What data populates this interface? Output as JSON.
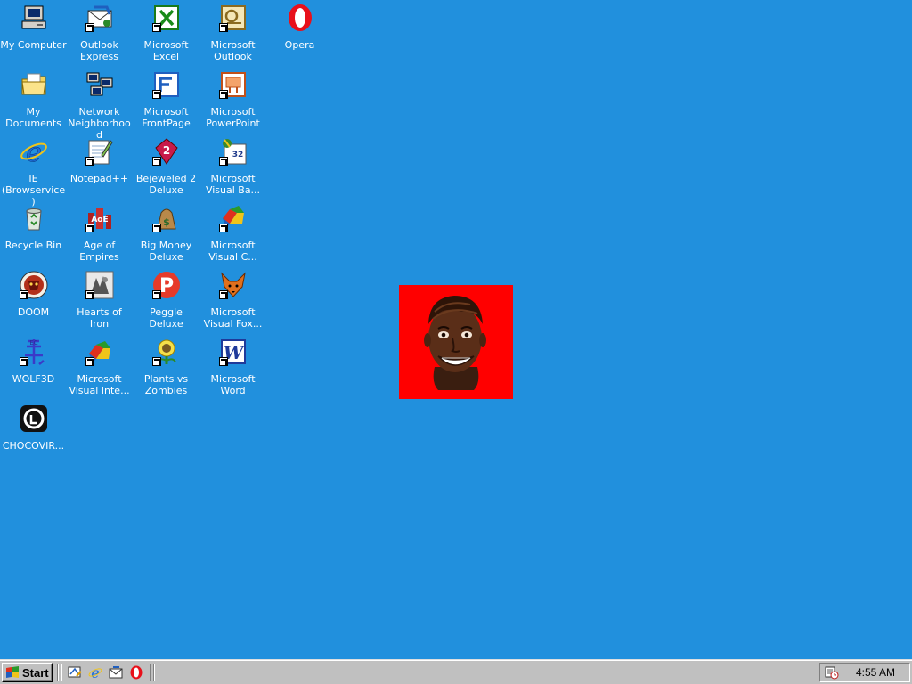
{
  "desktop": {
    "background_color": "#2190dd",
    "icons": [
      {
        "label": "My Computer",
        "icon": "my-computer-icon"
      },
      {
        "label": "My Documents",
        "icon": "my-documents-icon"
      },
      {
        "label": "IE\n(Browservice)",
        "icon": "internet-explorer-icon"
      },
      {
        "label": "Recycle Bin",
        "icon": "recycle-bin-icon"
      },
      {
        "label": "DOOM",
        "icon": "doom-icon"
      },
      {
        "label": "WOLF3D",
        "icon": "wolf3d-icon"
      },
      {
        "label": "CHOCOVIR...",
        "icon": "chocovir-icon"
      },
      {
        "label": "Outlook\nExpress",
        "icon": "outlook-express-icon"
      },
      {
        "label": "Network\nNeighborhood",
        "icon": "network-neighborhood-icon"
      },
      {
        "label": "Notepad++",
        "icon": "notepad-plus-plus-icon"
      },
      {
        "label": "Age of\nEmpires",
        "icon": "age-of-empires-icon"
      },
      {
        "label": "Hearts of Iron",
        "icon": "hearts-of-iron-icon"
      },
      {
        "label": "Microsoft\nVisual Inte...",
        "icon": "visual-interdev-icon"
      },
      {
        "label": "Microsoft\nExcel",
        "icon": "excel-icon"
      },
      {
        "label": "Microsoft\nFrontPage",
        "icon": "frontpage-icon"
      },
      {
        "label": "Bejeweled 2\nDeluxe",
        "icon": "bejeweled-icon"
      },
      {
        "label": "Big Money\nDeluxe",
        "icon": "big-money-icon"
      },
      {
        "label": "Peggle Deluxe",
        "icon": "peggle-icon"
      },
      {
        "label": "Plants vs\nZombies",
        "icon": "plants-vs-zombies-icon"
      },
      {
        "label": "Microsoft\nOutlook",
        "icon": "outlook-icon"
      },
      {
        "label": "Microsoft\nPowerPoint",
        "icon": "powerpoint-icon"
      },
      {
        "label": "Microsoft\nVisual Ba...",
        "icon": "visual-basic-icon"
      },
      {
        "label": "Microsoft\nVisual C...",
        "icon": "visual-cpp-icon"
      },
      {
        "label": "Microsoft\nVisual Fox...",
        "icon": "visual-foxpro-icon"
      },
      {
        "label": "Microsoft\nWord",
        "icon": "word-icon"
      },
      {
        "label": "Opera",
        "icon": "opera-icon"
      }
    ],
    "picture": {
      "background_color": "#ff0000",
      "content": "grinning-face-image"
    }
  },
  "taskbar": {
    "start_label": "Start",
    "quick_launch": [
      "show-desktop-icon",
      "internet-explorer-icon",
      "outlook-express-icon",
      "opera-icon"
    ],
    "clock": "4:55 AM",
    "tray_icon": "scheduler-tray-icon"
  }
}
